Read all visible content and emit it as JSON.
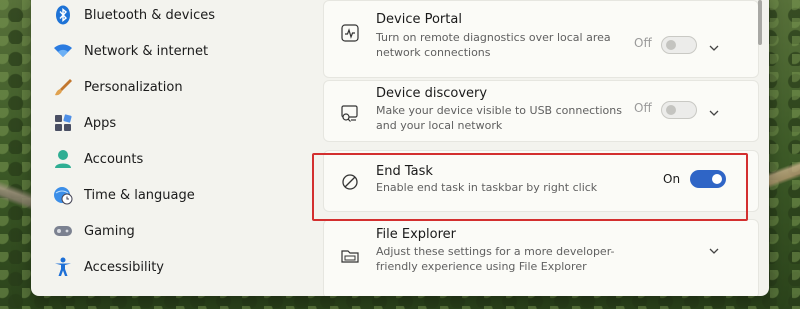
{
  "nav": {
    "items": [
      {
        "label": "Bluetooth & devices",
        "icon": "bluetooth-icon"
      },
      {
        "label": "Network & internet",
        "icon": "wifi-icon"
      },
      {
        "label": "Personalization",
        "icon": "paintbrush-icon"
      },
      {
        "label": "Apps",
        "icon": "apps-icon"
      },
      {
        "label": "Accounts",
        "icon": "person-icon"
      },
      {
        "label": "Time & language",
        "icon": "globe-clock-icon"
      },
      {
        "label": "Gaming",
        "icon": "gamepad-icon"
      },
      {
        "label": "Accessibility",
        "icon": "accessibility-icon"
      }
    ]
  },
  "settings": [
    {
      "title": "Device Portal",
      "description": "Turn on remote diagnostics over local area network connections",
      "state": "Off",
      "icon": "pulse-monitor-icon"
    },
    {
      "title": "Device discovery",
      "description": "Make your device visible to USB connections and your local network",
      "state": "Off",
      "icon": "device-search-icon"
    },
    {
      "title": "End Task",
      "description": "Enable end task in taskbar by right click",
      "state": "On",
      "icon": "prohibited-icon"
    },
    {
      "title": "File Explorer",
      "description": "Adjust these settings for a more developer-friendly experience using File Explorer",
      "icon": "folder-icon"
    }
  ],
  "colors": {
    "accent": "#2f65c6",
    "highlight": "#d32f2f"
  }
}
